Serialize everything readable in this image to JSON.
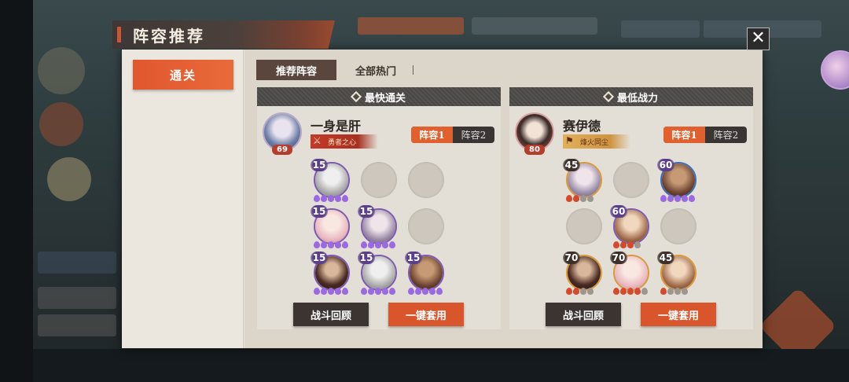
{
  "title": "阵容推荐",
  "close_icon": "close-icon",
  "sidebar": {
    "items": [
      {
        "label": "通关",
        "active": true
      }
    ]
  },
  "tabs": [
    {
      "label": "推荐阵容",
      "active": true
    },
    {
      "label": "全部热门",
      "active": false
    }
  ],
  "colors": {
    "accent": "#d9552b",
    "dark": "#3c3431",
    "header": "#4a4845"
  },
  "cards": [
    {
      "header": "最快通关",
      "leader": {
        "name": "一身是肝",
        "level": "69",
        "badge": "勇者之心"
      },
      "lineup_tabs": [
        "阵容1",
        "阵容2"
      ],
      "slots": [
        {
          "filled": true,
          "level": "15",
          "tone": "gray",
          "border": "purple",
          "pips": [
            "p",
            "p",
            "p",
            "p",
            "p"
          ]
        },
        {
          "filled": false
        },
        {
          "filled": false
        },
        {
          "filled": true,
          "level": "15",
          "tone": "pink",
          "border": "purple",
          "pips": [
            "p",
            "p",
            "p",
            "p",
            "p"
          ]
        },
        {
          "filled": true,
          "level": "15",
          "tone": "mauve",
          "border": "purple",
          "pips": [
            "p",
            "p",
            "p",
            "p",
            "p"
          ]
        },
        {
          "filled": false
        },
        {
          "filled": true,
          "level": "15",
          "tone": "dark",
          "border": "purple",
          "pips": [
            "p",
            "p",
            "p",
            "p",
            "p"
          ]
        },
        {
          "filled": true,
          "level": "15",
          "tone": "gray",
          "border": "purple",
          "pips": [
            "p",
            "p",
            "p",
            "p",
            "p"
          ]
        },
        {
          "filled": true,
          "level": "15",
          "tone": "brown",
          "border": "purple",
          "pips": [
            "p",
            "p",
            "p",
            "p",
            "p"
          ]
        }
      ],
      "buttons": {
        "review": "战斗回顾",
        "apply": "一键套用"
      }
    },
    {
      "header": "最低战力",
      "leader": {
        "name": "赛伊德",
        "level": "80",
        "badge": "烽火同尘"
      },
      "lineup_tabs": [
        "阵容1",
        "阵容2"
      ],
      "slots": [
        {
          "filled": true,
          "level": "45",
          "tone": "mauve",
          "border": "gold",
          "pips": [
            "r",
            "r",
            "g",
            "g"
          ]
        },
        {
          "filled": false
        },
        {
          "filled": true,
          "level": "60",
          "tone": "brown",
          "border": "blue",
          "pips": [
            "p",
            "p",
            "p",
            "p",
            "p"
          ]
        },
        {
          "filled": false
        },
        {
          "filled": true,
          "level": "60",
          "tone": "tan",
          "border": "purple",
          "pips": [
            "r",
            "r",
            "r",
            "g"
          ]
        },
        {
          "filled": false
        },
        {
          "filled": true,
          "level": "70",
          "tone": "dark",
          "border": "gold",
          "pips": [
            "r",
            "r",
            "g",
            "g"
          ]
        },
        {
          "filled": true,
          "level": "70",
          "tone": "pink",
          "border": "gold",
          "pips": [
            "r",
            "r",
            "r",
            "r",
            "g"
          ]
        },
        {
          "filled": true,
          "level": "45",
          "tone": "tan",
          "border": "gold",
          "pips": [
            "r",
            "g",
            "g",
            "g"
          ]
        }
      ],
      "buttons": {
        "review": "战斗回顾",
        "apply": "一键套用"
      }
    }
  ]
}
